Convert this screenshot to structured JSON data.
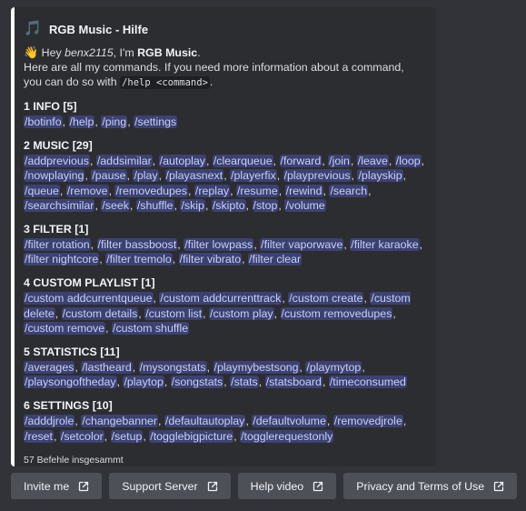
{
  "embed": {
    "author_icon": "🎵",
    "author_name": "RGB Music - Hilfe",
    "greeting": {
      "wave": "👋",
      "hey": "Hey ",
      "user": "benx2115",
      "im": ", I'm ",
      "bot": "RGB Music",
      "dot": ".",
      "line2": "Here are all my commands. If you need more information about a command, you can do so with ",
      "code": "/help <command>",
      "end": "."
    },
    "sections": [
      {
        "title": "1 INFO [5]",
        "commands": [
          "/botinfo",
          "/help",
          "/ping",
          "/settings"
        ]
      },
      {
        "title": "2 MUSIC [29]",
        "commands": [
          "/addprevious",
          "/addsimilar",
          "/autoplay",
          "/clearqueue",
          "/forward",
          "/join",
          "/leave",
          "/loop",
          "/nowplaying",
          "/pause",
          "/play",
          "/playasnext",
          "/playerfix",
          "/playprevious",
          "/playskip",
          "/queue",
          "/remove",
          "/removedupes",
          "/replay",
          "/resume",
          "/rewind",
          "/search",
          "/searchsimilar",
          "/seek",
          "/shuffle",
          "/skip",
          "/skipto",
          "/stop",
          "/volume"
        ]
      },
      {
        "title": "3 FILTER [1]",
        "commands": [
          "/filter rotation",
          "/filter bassboost",
          "/filter lowpass",
          "/filter vaporwave",
          "/filter karaoke",
          "/filter nightcore",
          "/filter tremolo",
          "/filter vibrato",
          "/filter clear"
        ]
      },
      {
        "title": "4 CUSTOM PLAYLIST [1]",
        "commands": [
          "/custom addcurrentqueue",
          "/custom addcurrenttrack",
          "/custom create",
          "/custom delete",
          "/custom details",
          "/custom list",
          "/custom play",
          "/custom removedupes",
          "/custom remove",
          "/custom shuffle"
        ]
      },
      {
        "title": "5 STATISTICS [11]",
        "commands": [
          "/averages",
          "/lastheard",
          "/mysongstats",
          "/playmybestsong",
          "/playmytop",
          "/playsongoftheday",
          "/playtop",
          "/songstats",
          "/stats",
          "/statsboard",
          "/timeconsumed"
        ]
      },
      {
        "title": "6 SETTINGS [10]",
        "commands": [
          "/adddjrole",
          "/changebanner",
          "/defaultautoplay",
          "/defaultvolume",
          "/removedjrole",
          "/reset",
          "/setcolor",
          "/setup",
          "/togglebigpicture",
          "/togglerequestonly"
        ]
      }
    ],
    "footer": "57 Befehle insgesammt"
  },
  "buttons": [
    {
      "label": "Invite me",
      "icon": "external-link-icon"
    },
    {
      "label": "Support Server",
      "icon": "external-link-icon"
    },
    {
      "label": "Help video",
      "icon": "external-link-icon"
    },
    {
      "label": "Privacy and Terms of Use",
      "icon": "external-link-icon"
    }
  ],
  "colors": {
    "background": "#313338",
    "embed": "#2b2d31",
    "embed_border": "#ffffff",
    "command_bg": "#3c4270",
    "button": "#4e5058"
  }
}
